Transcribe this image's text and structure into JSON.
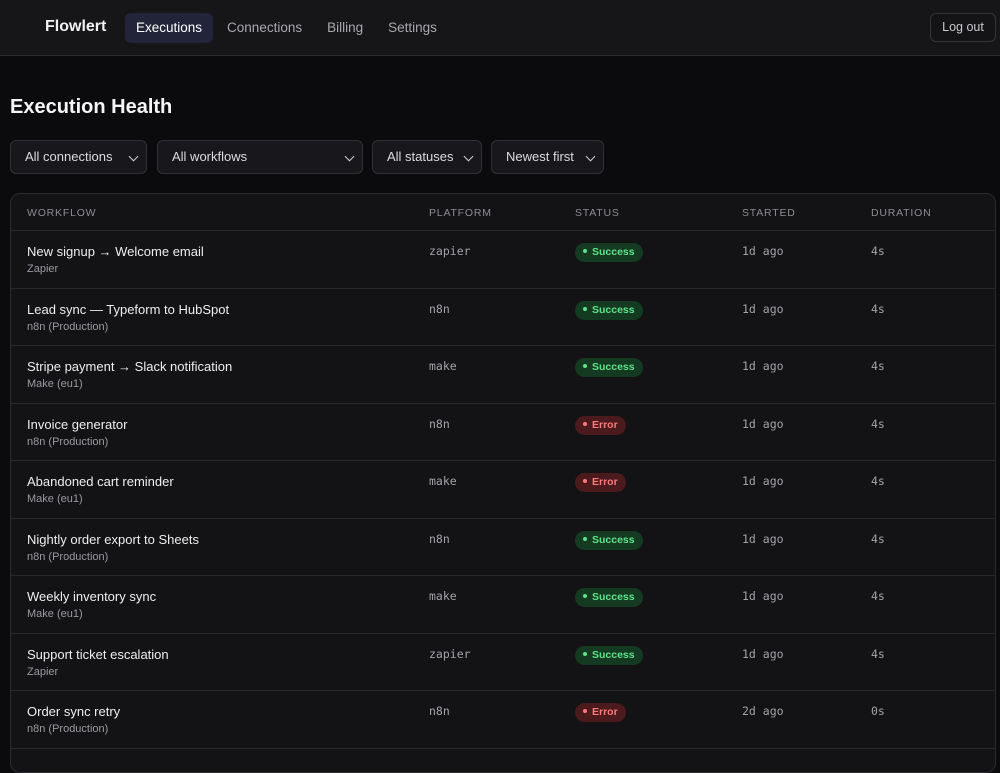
{
  "app": {
    "brand": "Flowlert",
    "nav": [
      "Executions",
      "Connections",
      "Billing",
      "Settings"
    ],
    "active_nav": "Executions",
    "logout_label": "Log out"
  },
  "page": {
    "title": "Execution Health"
  },
  "filters": {
    "connection": "All connections",
    "workflow": "All workflows",
    "status": "All statuses",
    "sort": "Newest first"
  },
  "table": {
    "headers": {
      "workflow": "WORKFLOW",
      "platform": "PLATFORM",
      "status": "STATUS",
      "started": "STARTED",
      "duration": "DURATION"
    },
    "rows": [
      {
        "name": "New signup → Welcome email",
        "connection": "Zapier",
        "platform": "zapier",
        "status": "Success",
        "started": "1d ago",
        "duration": "4s"
      },
      {
        "name": "Lead sync — Typeform to HubSpot",
        "connection": "n8n (Production)",
        "platform": "n8n",
        "status": "Success",
        "started": "1d ago",
        "duration": "4s"
      },
      {
        "name": "Stripe payment → Slack notification",
        "connection": "Make (eu1)",
        "platform": "make",
        "status": "Success",
        "started": "1d ago",
        "duration": "4s"
      },
      {
        "name": "Invoice generator",
        "connection": "n8n (Production)",
        "platform": "n8n",
        "status": "Error",
        "started": "1d ago",
        "duration": "4s"
      },
      {
        "name": "Abandoned cart reminder",
        "connection": "Make (eu1)",
        "platform": "make",
        "status": "Error",
        "started": "1d ago",
        "duration": "4s"
      },
      {
        "name": "Nightly order export to Sheets",
        "connection": "n8n (Production)",
        "platform": "n8n",
        "status": "Success",
        "started": "1d ago",
        "duration": "4s"
      },
      {
        "name": "Weekly inventory sync",
        "connection": "Make (eu1)",
        "platform": "make",
        "status": "Success",
        "started": "1d ago",
        "duration": "4s"
      },
      {
        "name": "Support ticket escalation",
        "connection": "Zapier",
        "platform": "zapier",
        "status": "Success",
        "started": "1d ago",
        "duration": "4s"
      },
      {
        "name": "Order sync retry",
        "connection": "n8n (Production)",
        "platform": "n8n",
        "status": "Error",
        "started": "2d ago",
        "duration": "0s"
      }
    ]
  },
  "colors": {
    "success": "#5fe38a",
    "error": "#ff7b7b",
    "active_nav_bg": "#22253a"
  }
}
